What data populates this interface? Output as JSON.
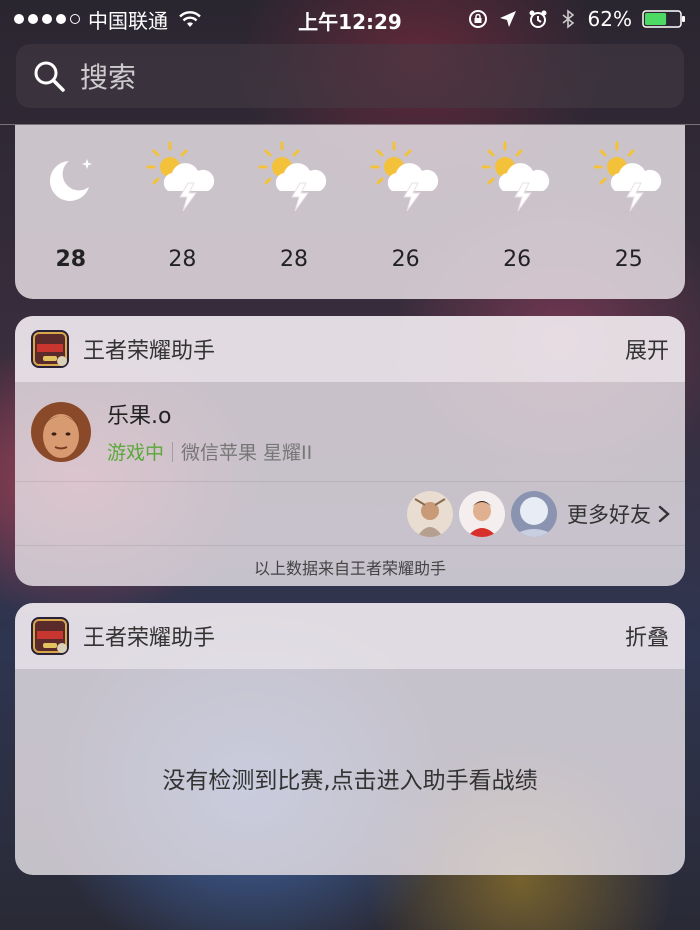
{
  "status_bar": {
    "carrier": "中国联通",
    "time": "上午12:29",
    "battery": "62%",
    "colors": {
      "battery_fill": "#4cd964"
    }
  },
  "search": {
    "placeholder": "搜索"
  },
  "weather": {
    "forecast": [
      {
        "icon": "moon-stars-icon",
        "temp": "28"
      },
      {
        "icon": "sun-thunder-icon",
        "temp": "28"
      },
      {
        "icon": "sun-thunder-icon",
        "temp": "28"
      },
      {
        "icon": "sun-thunder-icon",
        "temp": "26"
      },
      {
        "icon": "sun-thunder-icon",
        "temp": "26"
      },
      {
        "icon": "sun-thunder-icon",
        "temp": "25"
      }
    ]
  },
  "widget1": {
    "title": "王者荣耀助手",
    "action": "展开",
    "friend": {
      "name": "乐果.o",
      "status": "游戏中",
      "rank": "微信苹果 星耀II"
    },
    "more_label": "更多好友",
    "source_note": "以上数据来自王者荣耀助手"
  },
  "widget2": {
    "title": "王者荣耀助手",
    "action": "折叠",
    "message": "没有检测到比赛,点击进入助手看战绩"
  },
  "colors": {
    "in_game": "#5aa83a"
  }
}
